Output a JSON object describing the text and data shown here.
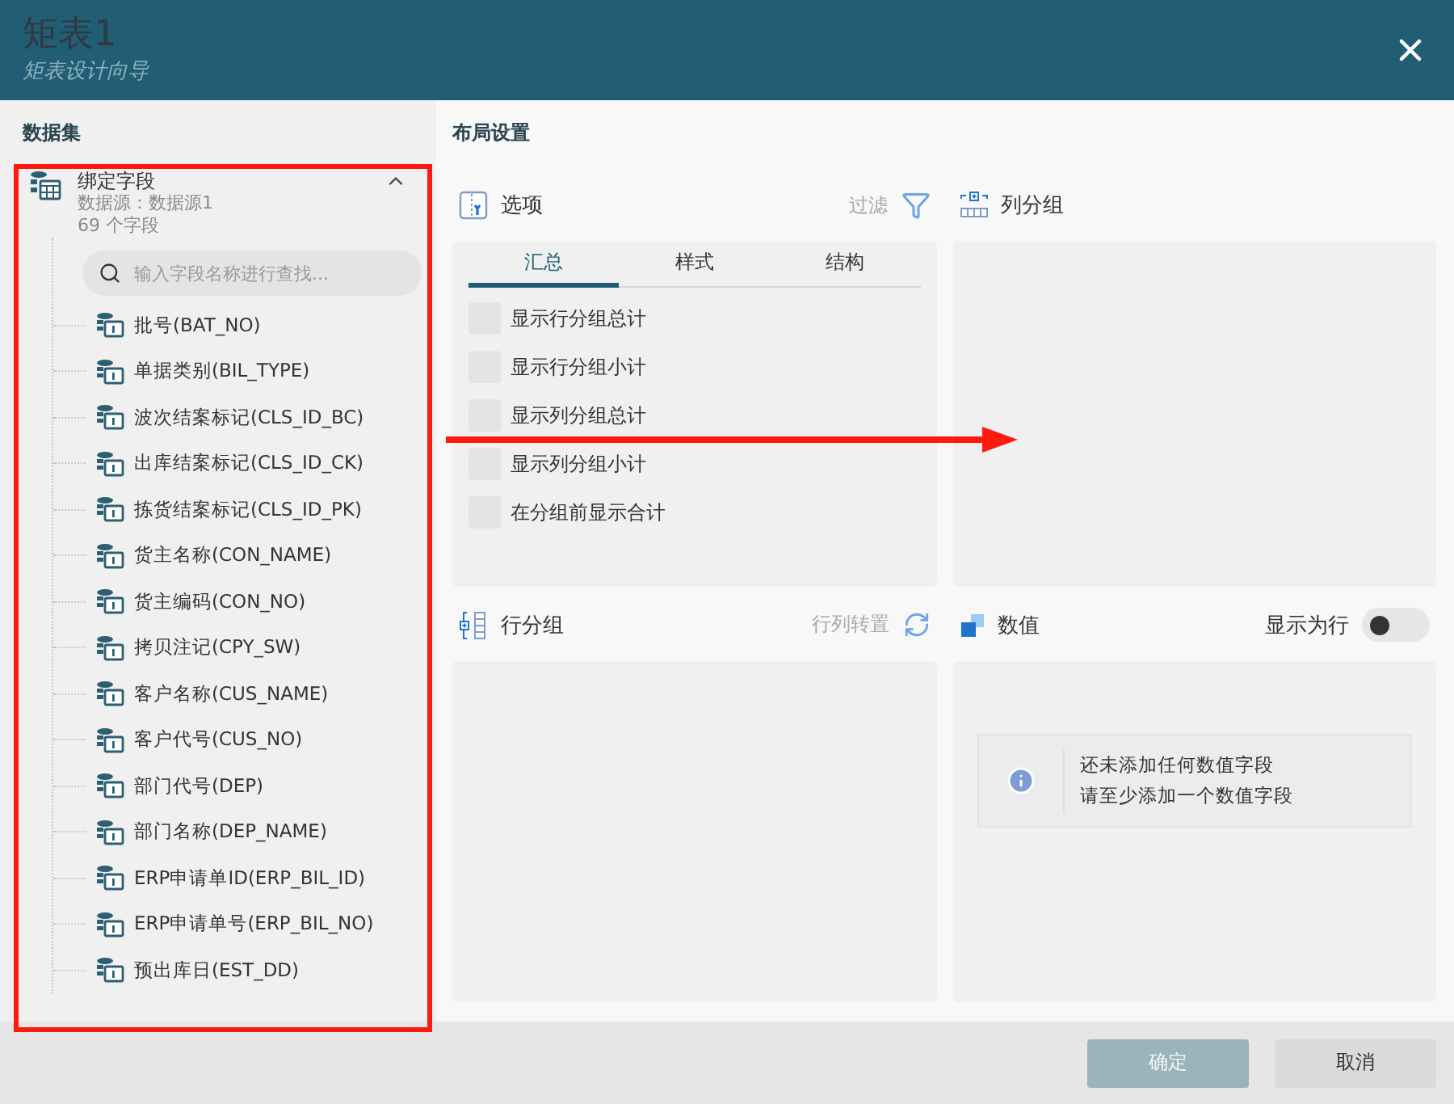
{
  "window": {
    "title": "矩表1",
    "subtitle": "矩表设计向导"
  },
  "dataset": {
    "heading": "数据集",
    "source": {
      "name": "绑定字段",
      "datasource": "数据源：数据源1",
      "count": "69 个字段",
      "expanded": true
    },
    "search": {
      "placeholder": "输入字段名称进行查找..."
    },
    "fields": [
      "批号(BAT_NO)",
      "单据类别(BIL_TYPE)",
      "波次结案标记(CLS_ID_BC)",
      "出库结案标记(CLS_ID_CK)",
      "拣货结案标记(CLS_ID_PK)",
      "货主名称(CON_NAME)",
      "货主编码(CON_NO)",
      "拷贝注记(CPY_SW)",
      "客户名称(CUS_NAME)",
      "客户代号(CUS_NO)",
      "部门代号(DEP)",
      "部门名称(DEP_NAME)",
      "ERP申请单ID(ERP_BIL_ID)",
      "ERP申请单号(ERP_BIL_NO)",
      "预出库日(EST_DD)"
    ]
  },
  "layout": {
    "heading": "布局设置",
    "options": {
      "title": "选项",
      "filter": "过滤",
      "tabs": [
        {
          "label": "汇总",
          "selected": true
        },
        {
          "label": "样式",
          "selected": false
        },
        {
          "label": "结构",
          "selected": false
        }
      ],
      "items": [
        {
          "label": "显示行分组总计",
          "checked": false
        },
        {
          "label": "显示行分组小计",
          "checked": false
        },
        {
          "label": "显示列分组总计",
          "checked": false
        },
        {
          "label": "显示列分组小计",
          "checked": false
        },
        {
          "label": "在分组前显示合计",
          "checked": false
        }
      ]
    },
    "column_groups": {
      "title": "列分组"
    },
    "row_groups": {
      "title": "行分组",
      "action": "行列转置"
    },
    "values": {
      "title": "数值",
      "toggle": {
        "label": "显示为行",
        "on": false
      },
      "message": [
        "还未添加任何数值字段",
        "请至少添加一个数值字段"
      ]
    }
  },
  "buttons": [
    {
      "label": "确定",
      "disabled": true
    },
    {
      "label": "取消",
      "disabled": false
    }
  ]
}
